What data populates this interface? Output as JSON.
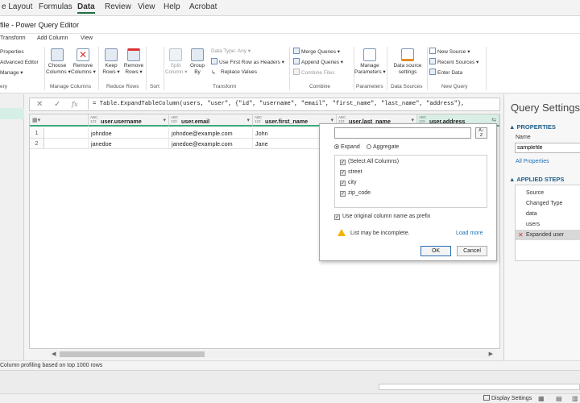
{
  "excel_tabs": [
    {
      "label": "e Layout"
    },
    {
      "label": "Formulas"
    },
    {
      "label": "Data",
      "active": true
    },
    {
      "label": "Review"
    },
    {
      "label": "View"
    },
    {
      "label": "Help"
    },
    {
      "label": "Acrobat"
    }
  ],
  "window_title": "file - Power Query Editor",
  "pq_tabs": [
    "Transform",
    "Add Column",
    "View"
  ],
  "ribbon": {
    "left_items": [
      "Properties",
      "Advanced Editor",
      "Manage ▾"
    ],
    "left_group": "ery",
    "choose_columns": "Choose\nColumns ▾",
    "remove_columns": "Remove\nColumns ▾",
    "manage_columns_group": "Manage Columns",
    "keep_rows": "Keep\nRows ▾",
    "remove_rows": "Remove\nRows ▾",
    "reduce_rows_group": "Reduce Rows",
    "sort_group": "Sort",
    "split_column": "Split\nColumn ▾",
    "group_by": "Group\nBy",
    "data_type": "Data Type: Any ▾",
    "first_row_headers": "Use First Row as Headers ▾",
    "replace_values": "Replace Values",
    "transform_group": "Transform",
    "merge_queries": "Merge Queries ▾",
    "append_queries": "Append Queries ▾",
    "combine_files": "Combine Files",
    "combine_group": "Combine",
    "manage_parameters": "Manage\nParameters ▾",
    "parameters_group": "Parameters",
    "data_source_settings": "Data source\nsettings",
    "data_sources_group": "Data Sources",
    "new_source": "New Source ▾",
    "recent_sources": "Recent Sources ▾",
    "enter_data": "Enter Data",
    "new_query_group": "New Query"
  },
  "formula": {
    "fx": "fx",
    "text": "= Table.ExpandTableColumn(users, \"user\", {\"id\", \"username\", \"email\", \"first_name\", \"last_name\", \"address\"},"
  },
  "grid": {
    "columns": [
      {
        "type": "ABC\n123",
        "name": "user.username"
      },
      {
        "type": "ABC\n123",
        "name": "user.email"
      },
      {
        "type": "ABC\n123",
        "name": "user.first_name"
      },
      {
        "type": "ABC\n123",
        "name": "user.last_name"
      },
      {
        "type": "ABC\n123",
        "name": "user.address"
      }
    ],
    "rows": [
      {
        "num": "1",
        "cells": [
          "johndoe",
          "johndoe@example.com",
          "John"
        ]
      },
      {
        "num": "2",
        "cells": [
          "janedoe",
          "janedoe@example.com",
          "Jane"
        ]
      }
    ]
  },
  "expand_popup": {
    "sort_label": "A↓\nZ",
    "expand": "Expand",
    "aggregate": "Aggregate",
    "columns": [
      "(Select All Columns)",
      "street",
      "city",
      "zip_code"
    ],
    "use_original": "Use original column name as prefix",
    "warning": "List may be incomplete.",
    "load_more": "Load more",
    "ok": "OK",
    "cancel": "Cancel"
  },
  "query_settings": {
    "title": "Query Settings",
    "properties": "PROPERTIES",
    "name_label": "Name",
    "name_value": "samplefile",
    "all_properties": "All Properties",
    "applied_steps": "APPLIED STEPS",
    "steps": [
      "Source",
      "Changed Type",
      "data",
      "users",
      "Expanded user"
    ]
  },
  "status": "Column profiling based on top 1000 rows",
  "display_settings": "Display Settings",
  "colors": {
    "accent_green": "#3da87b",
    "link_blue": "#1e6fb8",
    "warning": "#f5b400"
  }
}
